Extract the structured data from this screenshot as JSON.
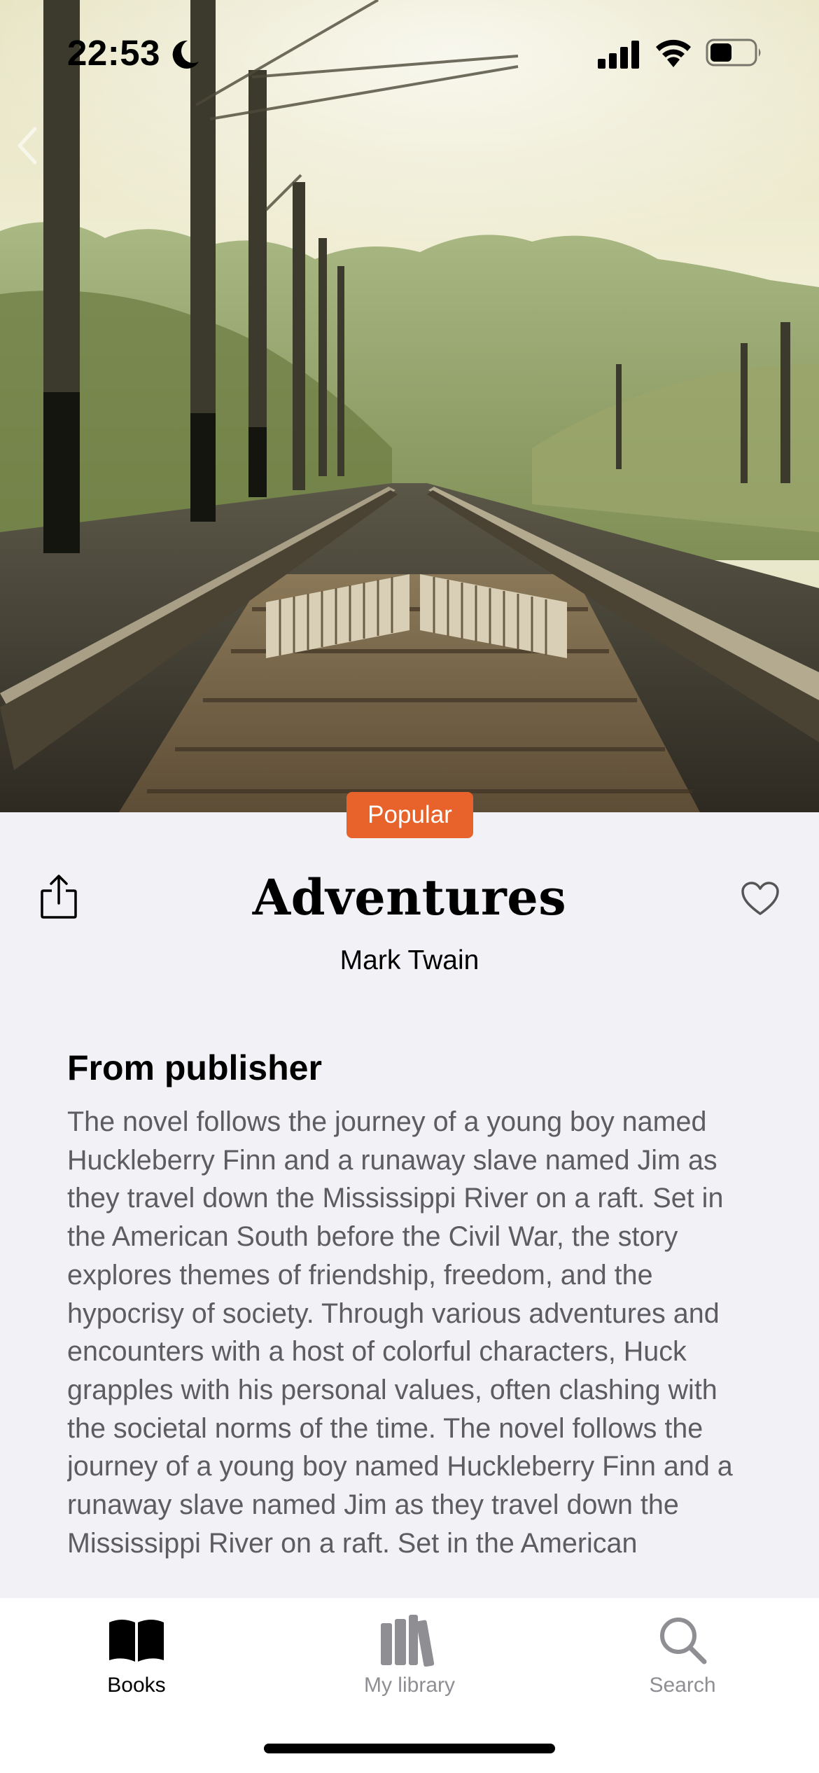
{
  "status_bar": {
    "time": "22:53"
  },
  "book": {
    "badge": "Popular",
    "title": "Adventures",
    "author": "Mark Twain"
  },
  "publisher_section": {
    "heading": "From publisher",
    "description": "The novel follows the journey of a young boy named Huckleberry Finn and a runaway slave named Jim as they travel down the Mississippi River on a raft. Set in the American South before the Civil War, the story explores themes of friendship, freedom, and the hypocrisy of society. Through various adventures and encounters with a host of colorful characters, Huck grapples with his personal values, often clashing with the societal norms of the time. The novel follows the journey of a young boy named Huckleberry Finn and a runaway slave named Jim as they travel down the Mississippi River on a raft. Set in the American"
  },
  "tab_bar": {
    "tabs": [
      {
        "label": "Books",
        "icon": "open-book-icon",
        "active": true
      },
      {
        "label": "My library",
        "icon": "library-icon",
        "active": false
      },
      {
        "label": "Search",
        "icon": "search-icon",
        "active": false
      }
    ]
  },
  "colors": {
    "badge": "#e8622b",
    "background": "#f2f1f6",
    "inactive_tab": "#8e8e93",
    "description_text": "#5c5c61"
  }
}
